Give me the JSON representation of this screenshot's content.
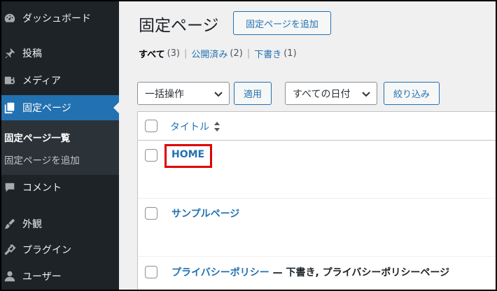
{
  "sidebar": {
    "items": [
      {
        "label": "ダッシュボード",
        "icon": "dashboard-icon"
      },
      {
        "label": "投稿",
        "icon": "pin-icon"
      },
      {
        "label": "メディア",
        "icon": "media-icon"
      },
      {
        "label": "固定ページ",
        "icon": "pages-icon"
      },
      {
        "label": "コメント",
        "icon": "comment-icon"
      },
      {
        "label": "外観",
        "icon": "brush-icon"
      },
      {
        "label": "プラグイン",
        "icon": "plugin-icon"
      },
      {
        "label": "ユーザー",
        "icon": "user-icon"
      }
    ],
    "submenu": {
      "current": "固定ページ一覧",
      "add": "固定ページを追加"
    }
  },
  "header": {
    "title": "固定ページ",
    "add_new_label": "固定ページを追加"
  },
  "filters": {
    "all_label": "すべて",
    "all_count": "(3)",
    "published_label": "公開済み",
    "published_count": "(2)",
    "draft_label": "下書き",
    "draft_count": "(1)",
    "separator": "|"
  },
  "bulk": {
    "selected": "一括操作",
    "apply_label": "適用"
  },
  "date_filter": {
    "selected": "すべての日付",
    "filter_label": "絞り込み"
  },
  "table": {
    "column_title": "タイトル",
    "rows": [
      {
        "title": "HOME",
        "state": ""
      },
      {
        "title": "サンプルページ",
        "state": ""
      },
      {
        "title": "プライバシーポリシー",
        "state": " — 下書き, プライバシーポリシーページ"
      }
    ]
  },
  "colors": {
    "accent": "#2271b1",
    "sidebar_bg": "#1d2327",
    "highlight": "#e00000"
  }
}
